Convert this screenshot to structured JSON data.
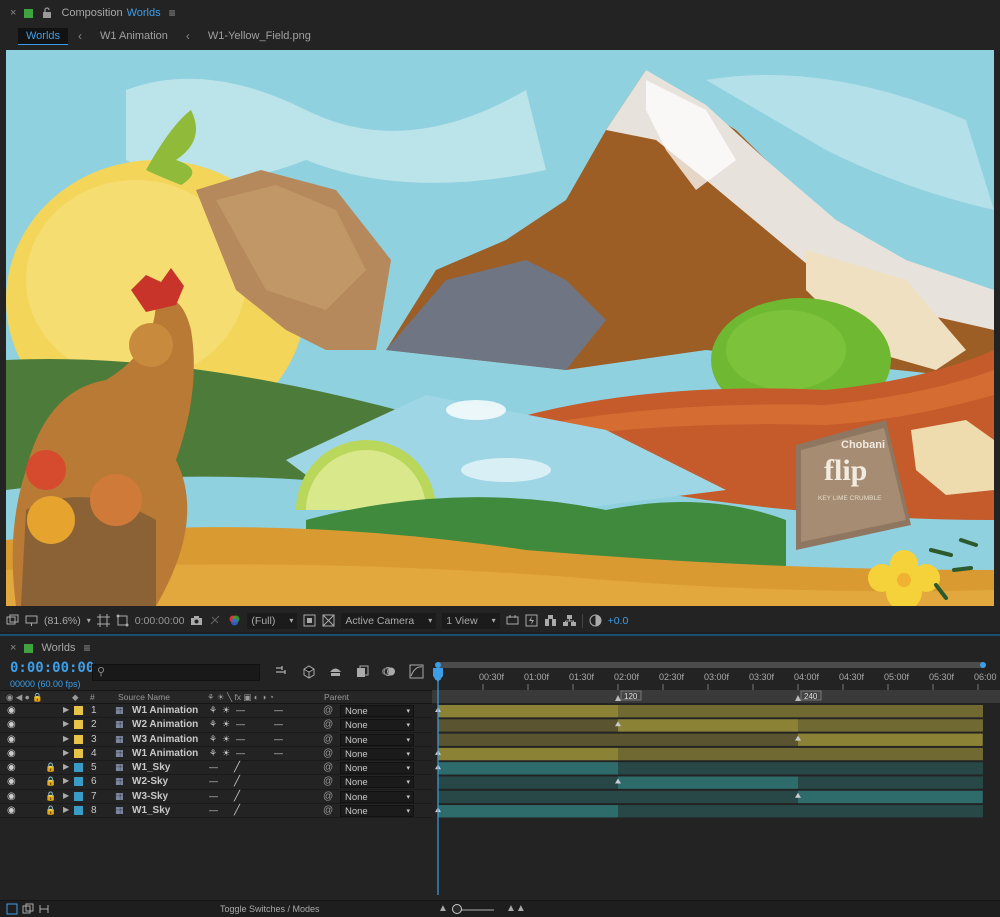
{
  "comp_panel": {
    "title_prefix": "Composition",
    "title_name": "Worlds",
    "breadcrumbs": [
      "Worlds",
      "W1 Animation",
      "W1-Yellow_Field.png"
    ]
  },
  "artwork": {
    "product_brand": "Chobani",
    "product_name": "flip",
    "product_flavor": "KEY LIME CRUMBLE"
  },
  "comp_toolbar": {
    "zoom": "(81.6%)",
    "timecode": "0:00:00:00",
    "resolution": "(Full)",
    "camera": "Active Camera",
    "views": "1 View",
    "exposure": "+0.0"
  },
  "timeline": {
    "title": "Worlds",
    "timecode": "0:00:00:00",
    "frame_fps": "00000 (60.00 fps)",
    "search_placeholder": "⚲",
    "columns": {
      "num": "#",
      "source": "Source Name",
      "parent": "Parent"
    },
    "ruler": [
      "0f",
      "00:30f",
      "01:00f",
      "01:30f",
      "02:00f",
      "02:30f",
      "03:00f",
      "03:30f",
      "04:00f",
      "04:30f",
      "05:00f",
      "05:30f",
      "06:00"
    ],
    "markers": [
      "120",
      "240"
    ],
    "layers": [
      {
        "num": "1",
        "name": "W1 Animation",
        "parent": "None",
        "label_color": "#e8c34a",
        "locked": false
      },
      {
        "num": "2",
        "name": "W2 Animation",
        "parent": "None",
        "label_color": "#e8c34a",
        "locked": false
      },
      {
        "num": "3",
        "name": "W3 Animation",
        "parent": "None",
        "label_color": "#e8c34a",
        "locked": false
      },
      {
        "num": "4",
        "name": "W1 Animation",
        "parent": "None",
        "label_color": "#e8c34a",
        "locked": false
      },
      {
        "num": "5",
        "name": "W1_Sky",
        "parent": "None",
        "label_color": "#3a9bc4",
        "locked": true
      },
      {
        "num": "6",
        "name": "W2-Sky",
        "parent": "None",
        "label_color": "#3a9bc4",
        "locked": true
      },
      {
        "num": "7",
        "name": "W3-Sky",
        "parent": "None",
        "label_color": "#3a9bc4",
        "locked": true
      },
      {
        "num": "8",
        "name": "W1_Sky",
        "parent": "None",
        "label_color": "#3a9bc4",
        "locked": true
      }
    ],
    "toggle_label": "Toggle Switches / Modes"
  },
  "colors": {
    "accent": "#3d9ee8",
    "precomp_bar": "#8c8236",
    "precomp_bar_dim": "#5a5530",
    "footage_bar": "#2e6b6b",
    "footage_bar_dim": "#284848"
  }
}
